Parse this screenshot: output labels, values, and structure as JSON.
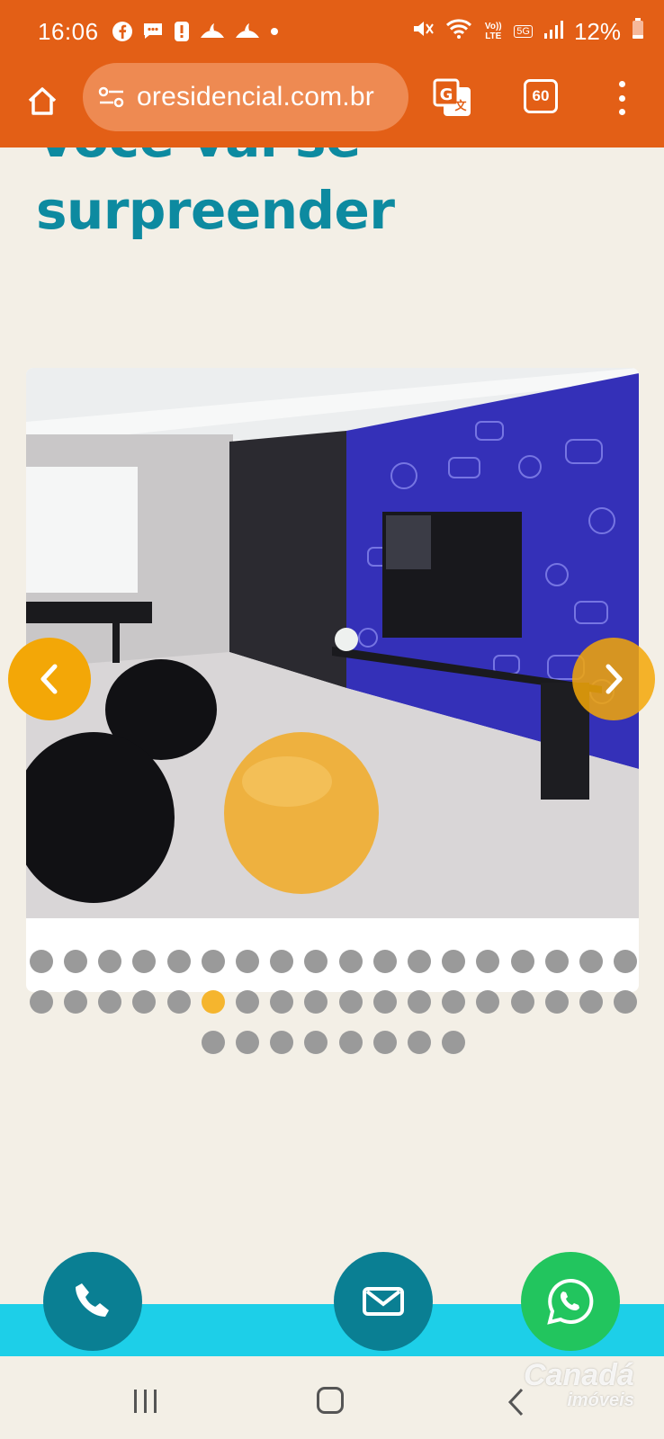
{
  "status_bar": {
    "time": "16:06",
    "battery": "12%",
    "notification_icons": [
      "facebook-icon",
      "chat-icon",
      "alert-icon",
      "bank-icon",
      "bank-icon",
      "dot-icon"
    ],
    "system_icons": [
      "mute-icon",
      "wifi-icon",
      "volte-icon",
      "5g-icon",
      "signal-icon",
      "battery-icon"
    ],
    "volte_label": "Vo)) LTE",
    "network_label": "5G"
  },
  "browser": {
    "url": "oresidencial.com.br",
    "tab_count": "60"
  },
  "page": {
    "heading_partial": "Você vai se",
    "heading": "surpreender"
  },
  "carousel": {
    "total_dots": 44,
    "active_index": 23
  },
  "fabs": {
    "phone": "phone-icon",
    "mail": "mail-icon",
    "whatsapp": "whatsapp-icon"
  },
  "watermark": {
    "main": "Canadá",
    "sub": "imóveis"
  },
  "colors": {
    "brand_orange": "#e35f16",
    "heading_teal": "#0d8aa0",
    "accent_yellow": "#f3a707",
    "fab_teal": "#0a7f93",
    "whatsapp_green": "#22c55e",
    "strip_cyan": "#1dcfe8",
    "background": "#f3efe6"
  }
}
